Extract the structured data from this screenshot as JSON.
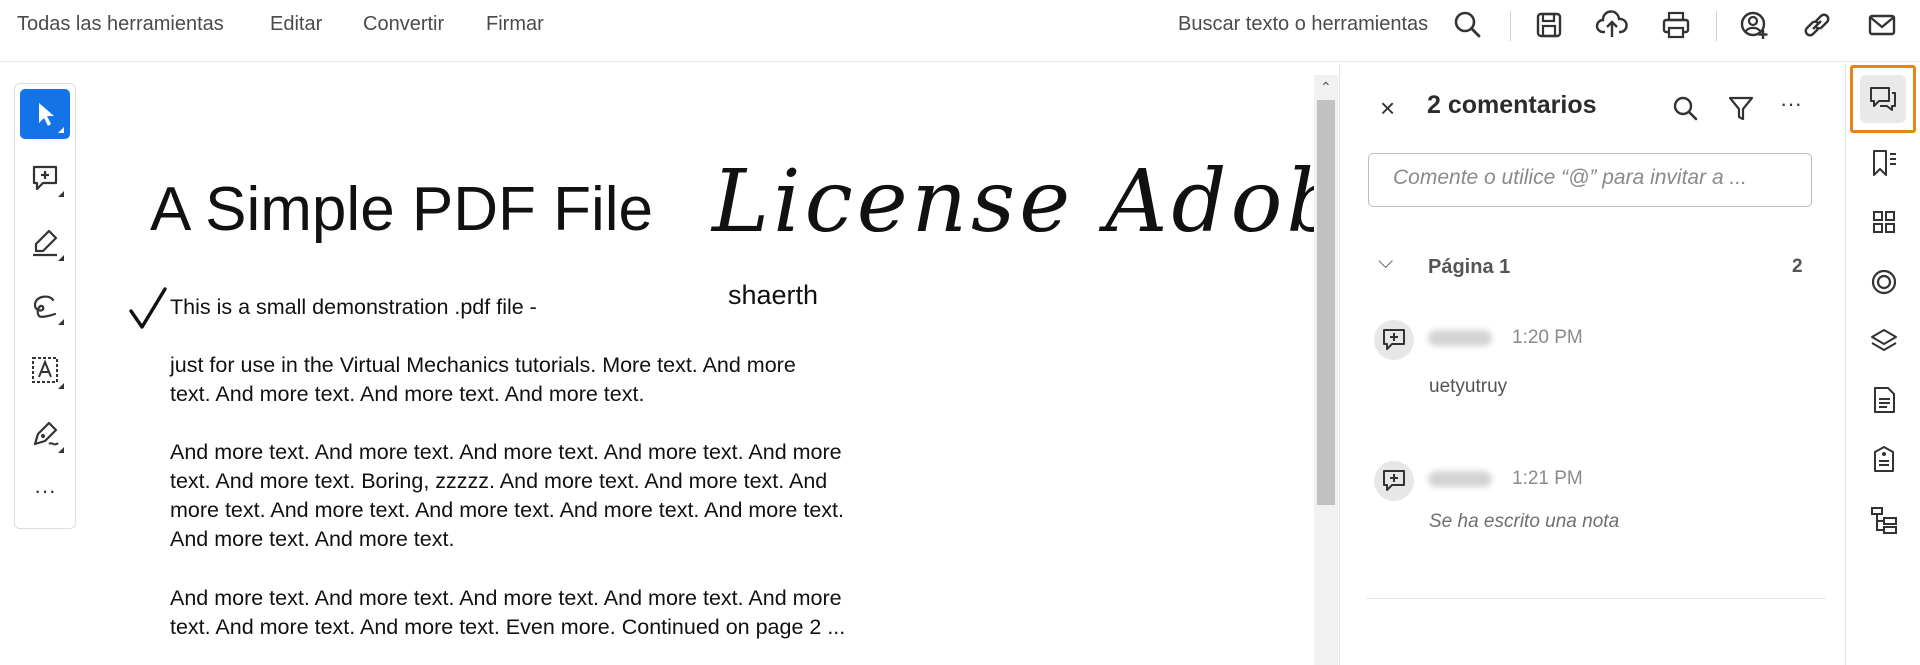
{
  "menu": {
    "all_tools": "Todas las herramientas",
    "edit": "Editar",
    "convert": "Convertir",
    "sign": "Firmar"
  },
  "toolbar": {
    "search_placeholder": "Buscar texto o herramientas",
    "icons": [
      "search-icon",
      "save-icon",
      "upload-icon",
      "print-icon",
      "share-user-icon",
      "link-icon",
      "mail-icon"
    ]
  },
  "tools_panel": {
    "items": [
      "select-pointer",
      "add-comment",
      "highlight-pen",
      "draw-freehand",
      "text-box",
      "sign"
    ],
    "more_label": "···",
    "active": "select-pointer"
  },
  "document": {
    "title": "A Simple PDF File",
    "signature": "License Adobecc",
    "signature_name": "shaerth",
    "lines": [
      "This is a small demonstration .pdf file -",
      "just for use in the Virtual Mechanics tutorials. More text. And more",
      "text. And more text. And more text. And more text.",
      "And more text. And more text. And more text. And more text. And more",
      "text. And more text. Boring, zzzzz. And more text. And more text. And",
      "more text. And more text. And more text. And more text. And more text.",
      "And more text. And more text.",
      "And more text. And more text. And more text. And more text. And more",
      "text. And more text. And more text. Even more. Continued on page 2 ..."
    ]
  },
  "comments_panel": {
    "close_label": "×",
    "title": "2 comentarios",
    "more_label": "···",
    "input_placeholder": "Comente o utilice “@” para invitar a ...",
    "page_group": {
      "label": "Página 1",
      "count": "2"
    },
    "comments": [
      {
        "time": "1:20 PM",
        "text": "uetyutruy"
      },
      {
        "time": "1:21 PM",
        "text": "Se ha escrito una nota"
      }
    ]
  },
  "right_rail": {
    "items": [
      "comments-icon",
      "bookmark-icon",
      "thumbnails-icon",
      "target-icon",
      "layers-icon",
      "document-icon",
      "attachment-icon",
      "structure-icon"
    ],
    "active": "comments-icon"
  },
  "colors": {
    "accent_blue": "#1473e6",
    "active_outline": "#e68619"
  }
}
